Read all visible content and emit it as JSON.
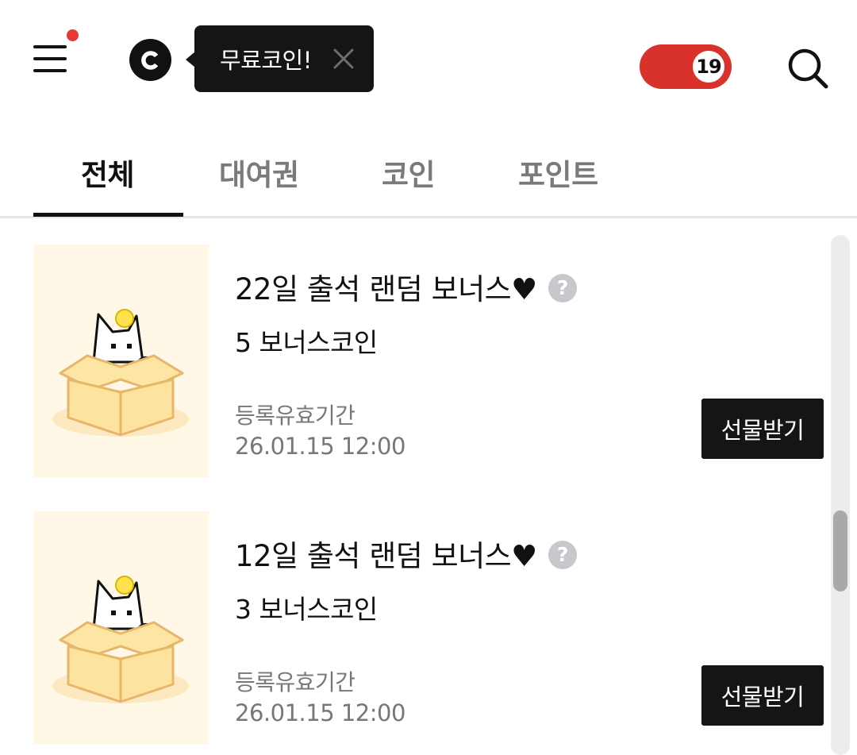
{
  "header": {
    "tooltip_text": "무료코인!",
    "adult_badge": "19",
    "accent_color": "#d9322c",
    "notification_dot_color": "#e53935"
  },
  "tabs": [
    {
      "label": "전체",
      "active": true
    },
    {
      "label": "대여권",
      "active": false
    },
    {
      "label": "코인",
      "active": false
    },
    {
      "label": "포인트",
      "active": false
    }
  ],
  "items": [
    {
      "title": "22일 출석 랜덤 보너스♥",
      "amount": "5 보너스코인",
      "period_label": "등록유효기간",
      "period_date": "26.01.15 12:00",
      "button_label": "선물받기"
    },
    {
      "title": "12일 출석 랜덤 보너스♥",
      "amount": "3 보너스코인",
      "period_label": "등록유효기간",
      "period_date": "26.01.15 12:00",
      "button_label": "선물받기"
    }
  ],
  "help_glyph": "?"
}
